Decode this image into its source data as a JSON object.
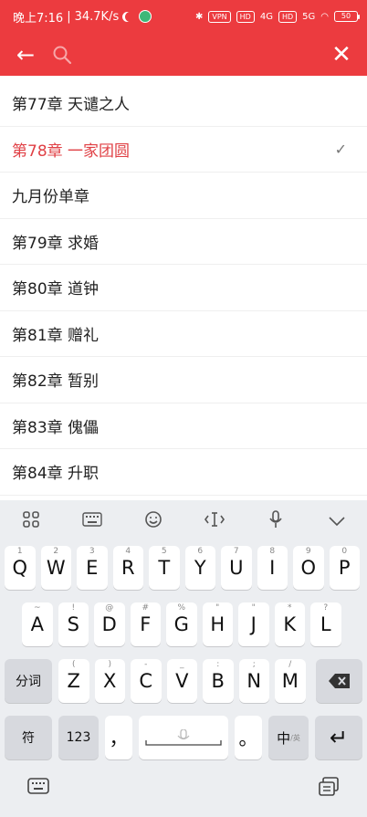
{
  "status": {
    "time": "晚上7:16",
    "speed": "34.7K/s",
    "vpn": "VPN",
    "hd1": "HD",
    "net1": "4G",
    "hd2": "HD",
    "net2": "5G",
    "battery": "50"
  },
  "appbar": {
    "back_icon": "←",
    "close_icon": "✕"
  },
  "chapters": [
    {
      "label": "第77章 天谴之人",
      "current": false
    },
    {
      "label": "第78章 一家团圆",
      "current": true
    },
    {
      "label": "九月份单章",
      "current": false
    },
    {
      "label": "第79章 求婚",
      "current": false
    },
    {
      "label": "第80章 道钟",
      "current": false
    },
    {
      "label": "第81章 赠礼",
      "current": false
    },
    {
      "label": "第82章 暂别",
      "current": false
    },
    {
      "label": "第83章 傀儡",
      "current": false
    },
    {
      "label": "第84章 升职",
      "current": false
    }
  ],
  "check_mark": "✓",
  "keyboard": {
    "toolbar": [
      "grid-icon",
      "keyboard-icon",
      "emoji-icon",
      "cursor-icon",
      "mic-icon",
      "collapse-icon"
    ],
    "row1": [
      {
        "k": "Q",
        "h": "1"
      },
      {
        "k": "W",
        "h": "2"
      },
      {
        "k": "E",
        "h": "3"
      },
      {
        "k": "R",
        "h": "4"
      },
      {
        "k": "T",
        "h": "5"
      },
      {
        "k": "Y",
        "h": "6"
      },
      {
        "k": "U",
        "h": "7"
      },
      {
        "k": "I",
        "h": "8"
      },
      {
        "k": "O",
        "h": "9"
      },
      {
        "k": "P",
        "h": "0"
      }
    ],
    "row2": [
      {
        "k": "A",
        "h": "~"
      },
      {
        "k": "S",
        "h": "!"
      },
      {
        "k": "D",
        "h": "@"
      },
      {
        "k": "F",
        "h": "#"
      },
      {
        "k": "G",
        "h": "%"
      },
      {
        "k": "H",
        "h": "\""
      },
      {
        "k": "J",
        "h": "\""
      },
      {
        "k": "K",
        "h": "*"
      },
      {
        "k": "L",
        "h": "?"
      }
    ],
    "row3": [
      {
        "k": "Z",
        "h": "("
      },
      {
        "k": "X",
        "h": ")"
      },
      {
        "k": "C",
        "h": "-"
      },
      {
        "k": "V",
        "h": "_"
      },
      {
        "k": "B",
        "h": ":"
      },
      {
        "k": "N",
        "h": ";"
      },
      {
        "k": "M",
        "h": "/"
      }
    ],
    "segment_label": "分词",
    "symbol_label": "符",
    "num_label": "123",
    "comma": "，",
    "period": "。",
    "zh_label": "中",
    "zh_sub": "/英",
    "enter_icon": "↵",
    "backspace_icon": "⌫"
  }
}
